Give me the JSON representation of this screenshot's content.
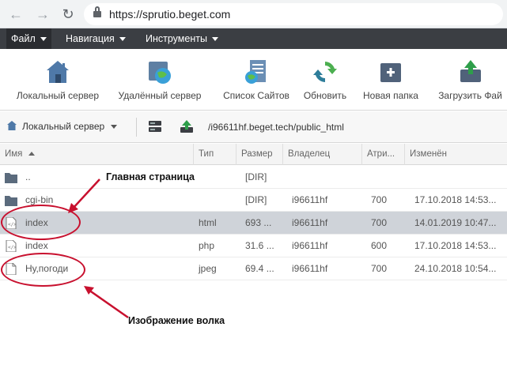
{
  "browser": {
    "url": "https://sprutio.beget.com",
    "icons": [
      "back-arrow-icon",
      "forward-arrow-icon",
      "reload-icon",
      "lock-icon"
    ]
  },
  "menu": [
    {
      "label": "Файл"
    },
    {
      "label": "Навигация"
    },
    {
      "label": "Инструменты"
    }
  ],
  "toolbar": [
    {
      "label": "Локальный сервер",
      "icon": "home-icon"
    },
    {
      "label": "Удалённый сервер",
      "icon": "remote-server-globe-icon"
    },
    {
      "label": "Список Сайтов",
      "icon": "sites-list-icon"
    },
    {
      "label": "Обновить",
      "icon": "refresh-icon"
    },
    {
      "label": "Новая папка",
      "icon": "new-folder-icon"
    },
    {
      "label": "Загрузить Фай",
      "icon": "upload-icon"
    }
  ],
  "pathbar": {
    "server": "Локальный сервер",
    "path": "/i96611hf.beget.tech/public_html"
  },
  "table": {
    "columns": [
      "Имя",
      "Тип",
      "Размер",
      "Владелец",
      "Атри...",
      "Изменён"
    ],
    "rows": [
      {
        "name": "..",
        "type": "",
        "size": "[DIR]",
        "owner": "",
        "attr": "",
        "modified": "",
        "icon": "folder-icon"
      },
      {
        "name": "cgi-bin",
        "type": "",
        "size": "[DIR]",
        "owner": "i96611hf",
        "attr": "700",
        "modified": "17.10.2018 14:53...",
        "icon": "folder-icon"
      },
      {
        "name": "index",
        "type": "html",
        "size": "693 ...",
        "owner": "i96611hf",
        "attr": "700",
        "modified": "14.01.2019 10:47...",
        "icon": "code-file-icon",
        "selected": true
      },
      {
        "name": "index",
        "type": "php",
        "size": "31.6 ...",
        "owner": "i96611hf",
        "attr": "600",
        "modified": "17.10.2018 14:53...",
        "icon": "code-file-icon"
      },
      {
        "name": "Ну,погоди",
        "type": "jpeg",
        "size": "69.4 ...",
        "owner": "i96611hf",
        "attr": "700",
        "modified": "24.10.2018 10:54...",
        "icon": "file-icon"
      }
    ]
  },
  "annotations": {
    "main_page": "Главная страница",
    "wolf_image": "Изображение волка",
    "color": "#c8102e"
  }
}
